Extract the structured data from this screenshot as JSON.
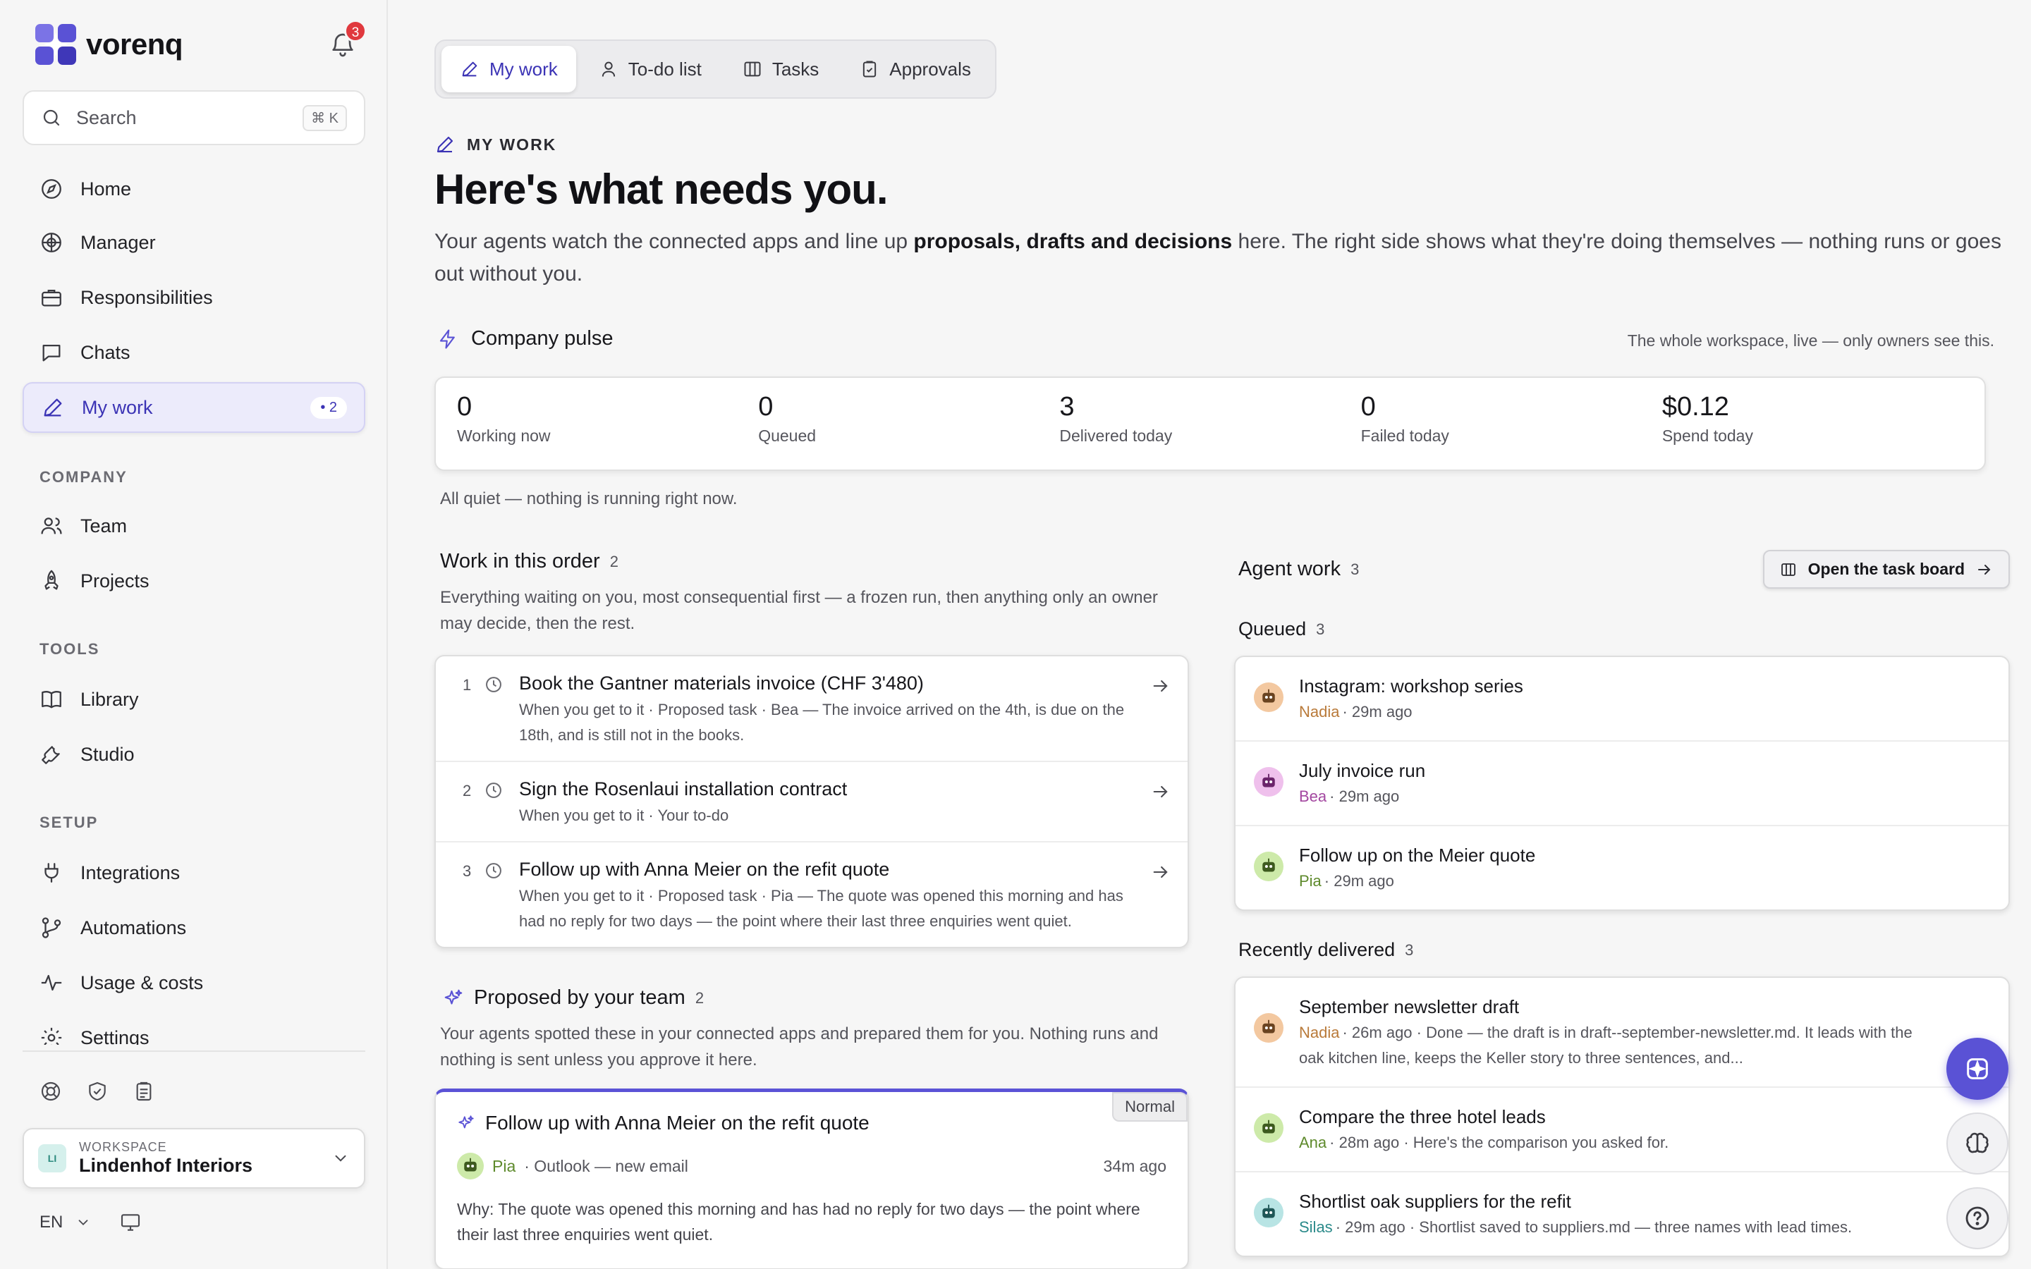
{
  "app": {
    "name": "vorenq",
    "notifications_count": "3",
    "brand_color": "#5a52d5"
  },
  "sidebar": {
    "search_label": "Search",
    "search_shortcut": "⌘ K",
    "nav": [
      {
        "label": "Home",
        "icon": "compass-icon"
      },
      {
        "label": "Manager",
        "icon": "manager-icon"
      },
      {
        "label": "Responsibilities",
        "icon": "briefcase-icon"
      },
      {
        "label": "Chats",
        "icon": "chat-icon"
      },
      {
        "label": "My work",
        "icon": "pencil-icon",
        "count": "• 2",
        "active": true
      }
    ],
    "company_label": "COMPANY",
    "company_nav": [
      {
        "label": "Team",
        "icon": "users-icon"
      },
      {
        "label": "Projects",
        "icon": "rocket-icon"
      }
    ],
    "tools_label": "TOOLS",
    "tools_nav": [
      {
        "label": "Library",
        "icon": "book-icon"
      },
      {
        "label": "Studio",
        "icon": "wrench-icon"
      }
    ],
    "setup_label": "SETUP",
    "setup_nav": [
      {
        "label": "Integrations",
        "icon": "plug-icon"
      },
      {
        "label": "Automations",
        "icon": "branch-icon"
      },
      {
        "label": "Usage & costs",
        "icon": "pulse-icon"
      },
      {
        "label": "Settings",
        "icon": "gear-icon"
      }
    ],
    "workspace": {
      "caption": "WORKSPACE",
      "name": "Lindenhof Interiors",
      "initials": "LI"
    },
    "language": "EN"
  },
  "tabs": [
    {
      "label": "My work",
      "active": true
    },
    {
      "label": "To-do list"
    },
    {
      "label": "Tasks"
    },
    {
      "label": "Approvals"
    }
  ],
  "page": {
    "eyebrow": "MY WORK",
    "title": "Here's what needs you.",
    "lead_before": "Your agents watch the connected apps and line up ",
    "lead_bold": "proposals, drafts and decisions",
    "lead_after": " here. The right side shows what they're doing themselves — nothing runs or goes out without you."
  },
  "pulse": {
    "title": "Company pulse",
    "note": "The whole workspace, live — only owners see this.",
    "stats": [
      {
        "value": "0",
        "label": "Working now"
      },
      {
        "value": "0",
        "label": "Queued"
      },
      {
        "value": "3",
        "label": "Delivered today"
      },
      {
        "value": "0",
        "label": "Failed today"
      },
      {
        "value": "$0.12",
        "label": "Spend today"
      }
    ],
    "status": "All quiet — nothing is running right now."
  },
  "work_order": {
    "title": "Work in this order",
    "count": "2",
    "description": "Everything waiting on you, most consequential first — a frozen run, then anything only an owner may decide, then the rest.",
    "items": [
      {
        "num": "1",
        "title": "Book the Gantner materials invoice (CHF 3'480)",
        "sub": "When you get to it · Proposed task · Bea — The invoice arrived on the 4th, is due on the 18th, and is still not in the books."
      },
      {
        "num": "2",
        "title": "Sign the Rosenlaui installation contract",
        "sub": "When you get to it · Your to-do"
      },
      {
        "num": "3",
        "title": "Follow up with Anna Meier on the refit quote",
        "sub": "When you get to it · Proposed task · Pia — The quote was opened this morning and has had no reply for two days — the point where their last three enquiries went quiet."
      }
    ]
  },
  "proposed": {
    "title": "Proposed by your team",
    "count": "2",
    "description": "Your agents spotted these in your connected apps and prepared them for you. Nothing runs and nothing is sent unless you approve it here.",
    "card": {
      "priority": "Normal",
      "title": "Follow up with Anna Meier on the refit quote",
      "agent": "Pia",
      "source": "· Outlook — new email",
      "time": "34m ago",
      "why": "Why: The quote was opened this morning and has had no reply for two days — the point where their last three enquiries went quiet."
    }
  },
  "agent_work": {
    "title": "Agent work",
    "count": "3",
    "open_board": "Open the task board",
    "queued_label": "Queued",
    "queued_count": "3",
    "queued": [
      {
        "title": "Instagram: workshop series",
        "agent": "Nadia",
        "meta": "· 29m ago",
        "color": "#f3c8a0",
        "agent_color": "#b97a3a"
      },
      {
        "title": "July invoice run",
        "agent": "Bea",
        "meta": "· 29m ago",
        "color": "#efc0ec",
        "agent_color": "#a347a0"
      },
      {
        "title": "Follow up on the Meier quote",
        "agent": "Pia",
        "meta": "· 29m ago",
        "color": "#cdeaa9",
        "agent_color": "#5e8a2c"
      }
    ],
    "delivered_label": "Recently delivered",
    "delivered_count": "3",
    "delivered": [
      {
        "title": "September newsletter draft",
        "agent": "Nadia",
        "meta": "· 26m ago · Done — the draft is in draft--september-newsletter.md. It leads with the oak kitchen line, keeps the Keller story to three sentences, and...",
        "color": "#f3c8a0",
        "agent_color": "#b97a3a"
      },
      {
        "title": "Compare the three hotel leads",
        "agent": "Ana",
        "meta": "· 28m ago · Here's the comparison you asked for.",
        "color": "#cdeaa9",
        "agent_color": "#5e8a2c"
      },
      {
        "title": "Shortlist oak suppliers for the refit",
        "agent": "Silas",
        "meta": "· 29m ago · Shortlist saved to suppliers.md — three names with lead times.",
        "color": "#b8e4e4",
        "agent_color": "#2b8a8a"
      }
    ]
  }
}
